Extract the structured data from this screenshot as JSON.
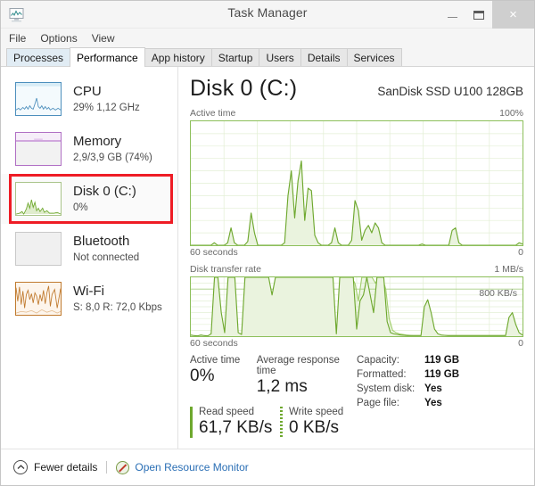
{
  "window": {
    "title": "Task Manager",
    "icon": "task-manager-icon",
    "buttons": {
      "minimize": "—",
      "maximize": "❐",
      "close": "×"
    }
  },
  "menu": {
    "items": [
      "File",
      "Options",
      "View"
    ]
  },
  "tabs": [
    {
      "label": "Processes",
      "selected": false
    },
    {
      "label": "Performance",
      "selected": true
    },
    {
      "label": "App history",
      "selected": false
    },
    {
      "label": "Startup",
      "selected": false
    },
    {
      "label": "Users",
      "selected": false
    },
    {
      "label": "Details",
      "selected": false
    },
    {
      "label": "Services",
      "selected": false
    }
  ],
  "sidebar": {
    "items": [
      {
        "title": "CPU",
        "sub": "29%  1,12 GHz",
        "color": "#4d8fbd",
        "selected": false
      },
      {
        "title": "Memory",
        "sub": "2,9/3,9 GB (74%)",
        "color": "#b06fc4",
        "selected": false
      },
      {
        "title": "Disk 0 (C:)",
        "sub": "0%",
        "color": "#6ea82e",
        "selected": true
      },
      {
        "title": "Bluetooth",
        "sub": "Not connected",
        "color": "#c8c8c8",
        "selected": false
      },
      {
        "title": "Wi-Fi",
        "sub": "S: 8,0 R: 72,0 Kbps",
        "color": "#c07a2e",
        "selected": false
      }
    ],
    "selection_color": "#ee1c25"
  },
  "main": {
    "title": "Disk 0 (C:)",
    "model": "SanDisk SSD U100 128GB",
    "accent_color": "#6ea82e"
  },
  "chart_data": [
    {
      "type": "area",
      "title": "Active time",
      "ymax_label": "100%",
      "xleft_label": "60 seconds",
      "xright_label": "0",
      "ylim": [
        0,
        100
      ],
      "xlabel": "",
      "ylabel": "Active time (%)",
      "grid": true,
      "line_color": "#6ea82e",
      "fill_color": "#eaf3de",
      "values": [
        0,
        0,
        0,
        0,
        0,
        0,
        0,
        2,
        0,
        0,
        0,
        2,
        14,
        2,
        0,
        0,
        0,
        3,
        26,
        10,
        0,
        0,
        0,
        0,
        0,
        0,
        0,
        0,
        2,
        40,
        60,
        22,
        52,
        68,
        20,
        46,
        44,
        8,
        2,
        0,
        0,
        0,
        2,
        14,
        2,
        0,
        0,
        0,
        4,
        36,
        28,
        4,
        12,
        16,
        10,
        18,
        14,
        2,
        0,
        0,
        0,
        0,
        0,
        0,
        0,
        0,
        0,
        0,
        0,
        1,
        0,
        0,
        0,
        0,
        0,
        0,
        0,
        0,
        12,
        14,
        2,
        0,
        0,
        0,
        0,
        0,
        0,
        0,
        0,
        0,
        0,
        0,
        0,
        0,
        0,
        0,
        0,
        0,
        2,
        1
      ]
    },
    {
      "type": "area",
      "title": "Disk transfer rate",
      "ymax_label": "1 MB/s",
      "ymid_label": "800 KB/s",
      "xleft_label": "60 seconds",
      "xright_label": "0",
      "ylim": [
        0,
        1000
      ],
      "xlabel": "",
      "ylabel": "Transfer rate",
      "grid": true,
      "series": [
        {
          "name": "read",
          "line_color": "#6ea82e",
          "fill_color": "#eaf3de",
          "values": [
            20,
            10,
            5,
            20,
            10,
            5,
            40,
            1000,
            1000,
            400,
            60,
            1000,
            1000,
            1000,
            60,
            30,
            1000,
            1000,
            1000,
            1000,
            1000,
            1000,
            1000,
            1000,
            700,
            1000,
            1000,
            1000,
            1000,
            1000,
            1000,
            1000,
            1000,
            1000,
            1000,
            1000,
            1000,
            1000,
            1000,
            1000,
            1000,
            1000,
            1000,
            40,
            1000,
            1000,
            1000,
            1000,
            1000,
            120,
            600,
            700,
            1000,
            700,
            400,
            1000,
            1000,
            1000,
            250,
            60,
            40,
            30,
            20,
            15,
            10,
            10,
            10,
            10,
            10,
            500,
            620,
            400,
            120,
            40,
            20,
            15,
            10,
            10,
            10,
            10,
            10,
            10,
            10,
            10,
            10,
            10,
            10,
            10,
            10,
            10,
            10,
            10,
            10,
            10,
            320,
            400,
            200,
            60,
            20
          ]
        },
        {
          "name": "write",
          "line_color": "#a3cf6e",
          "fill_color": "rgba(163,207,110,0.18)",
          "values": [
            10,
            5,
            5,
            10,
            5,
            5,
            10,
            20,
            15,
            10,
            10,
            30,
            20,
            15,
            10,
            10,
            40,
            60,
            80,
            70,
            100,
            140,
            120,
            160,
            130,
            170,
            150,
            190,
            160,
            200,
            180,
            150,
            130,
            110,
            90,
            80,
            60,
            50,
            40,
            30,
            20,
            15,
            10,
            10,
            20,
            40,
            1000,
            1000,
            900,
            600,
            1000,
            1000,
            1000,
            1000,
            900,
            1000,
            1000,
            800,
            300,
            100,
            60,
            40,
            30,
            20,
            15,
            10,
            10,
            10,
            10,
            40,
            60,
            40,
            20,
            10,
            10,
            10,
            10,
            10,
            10,
            10,
            10,
            10,
            10,
            10,
            10,
            10,
            10,
            10,
            10,
            10,
            10,
            10,
            10,
            60,
            80,
            40,
            20,
            10
          ]
        }
      ]
    }
  ],
  "stats": {
    "active_time": {
      "label": "Active time",
      "value": "0%"
    },
    "avg_response": {
      "label": "Average response time",
      "value": "1,2 ms"
    },
    "read_speed": {
      "label": "Read speed",
      "value": "61,7 KB/s",
      "marker": "solid"
    },
    "write_speed": {
      "label": "Write speed",
      "value": "0 KB/s",
      "marker": "dotted"
    },
    "details": [
      {
        "key": "Capacity:",
        "value": "119 GB"
      },
      {
        "key": "Formatted:",
        "value": "119 GB"
      },
      {
        "key": "System disk:",
        "value": "Yes"
      },
      {
        "key": "Page file:",
        "value": "Yes"
      }
    ]
  },
  "footer": {
    "fewer_details": "Fewer details",
    "resource_monitor": "Open Resource Monitor"
  }
}
